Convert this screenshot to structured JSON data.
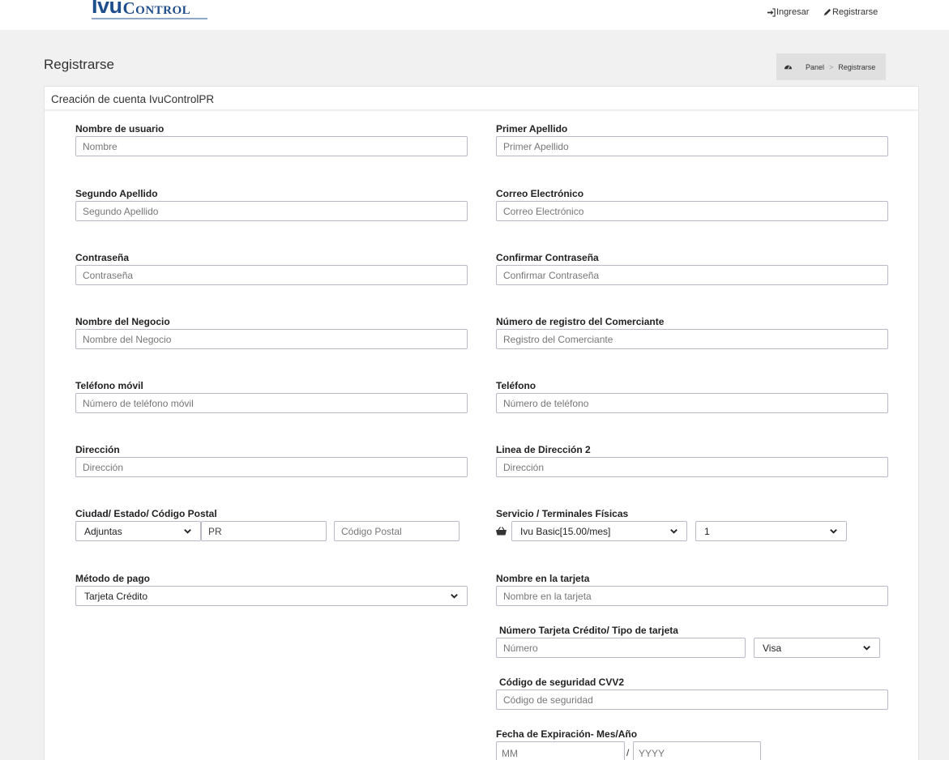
{
  "header": {
    "logo_ivu": "Ivu",
    "logo_control": "Control",
    "login_label": "Ingresar",
    "register_label": "Registrarse"
  },
  "page": {
    "title": "Registrarse",
    "breadcrumb": {
      "home": "Panel",
      "separator": ">",
      "current": "Registrarse"
    }
  },
  "panel": {
    "title": "Creación de cuenta IvuControlPR"
  },
  "form": {
    "username": {
      "label": "Nombre de usuario",
      "placeholder": "Nombre"
    },
    "first_lastname": {
      "label": "Primer Apellido",
      "placeholder": "Primer Apellido"
    },
    "second_lastname": {
      "label": "Segundo Apellido",
      "placeholder": "Segundo Apellido"
    },
    "email": {
      "label": "Correo Electrónico",
      "placeholder": "Correo Electrónico"
    },
    "password": {
      "label": "Contraseña",
      "placeholder": "Contraseña"
    },
    "confirm_password": {
      "label": "Confirmar Contraseña",
      "placeholder": "Confirmar Contraseña"
    },
    "business_name": {
      "label": "Nombre del Negocio",
      "placeholder": "Nombre del Negocio"
    },
    "merchant_number": {
      "label": "Número de registro del Comerciante",
      "placeholder": "Registro del Comerciante"
    },
    "mobile": {
      "label": "Teléfono móvil",
      "placeholder": "Número de teléfono móvil"
    },
    "phone": {
      "label": "Teléfono",
      "placeholder": "Número de teléfono"
    },
    "address": {
      "label": "Dirección",
      "placeholder": "Dirección"
    },
    "address2": {
      "label": "Linea de Dirección 2",
      "placeholder": "Dirección"
    },
    "city_state_zip": {
      "label": "Ciudad/ Estado/ Código Postal",
      "city_value": "Adjuntas",
      "state_value": "PR",
      "zip_placeholder": "Código Postal"
    },
    "service": {
      "label": "Servicio / Terminales Físicas",
      "plan_value": "Ivu Basic[15.00/mes]",
      "terminals_value": "1"
    },
    "payment_method": {
      "label": "Método de pago",
      "value": "Tarjeta Crédito"
    },
    "card_name": {
      "label": "Nombre en la tarjeta",
      "placeholder": "Nombre en la tarjeta"
    },
    "card_number": {
      "label": "Número Tarjeta Crédito/ Tipo de tarjeta",
      "placeholder": "Número",
      "type_value": "Visa"
    },
    "cvv": {
      "label": "Código de seguridad CVV2",
      "placeholder": "Código de seguridad"
    },
    "expiration": {
      "label": "Fecha de Expiración- Mes/Año",
      "month_placeholder": "MM",
      "separator": "/",
      "year_placeholder": "YYYY"
    }
  }
}
